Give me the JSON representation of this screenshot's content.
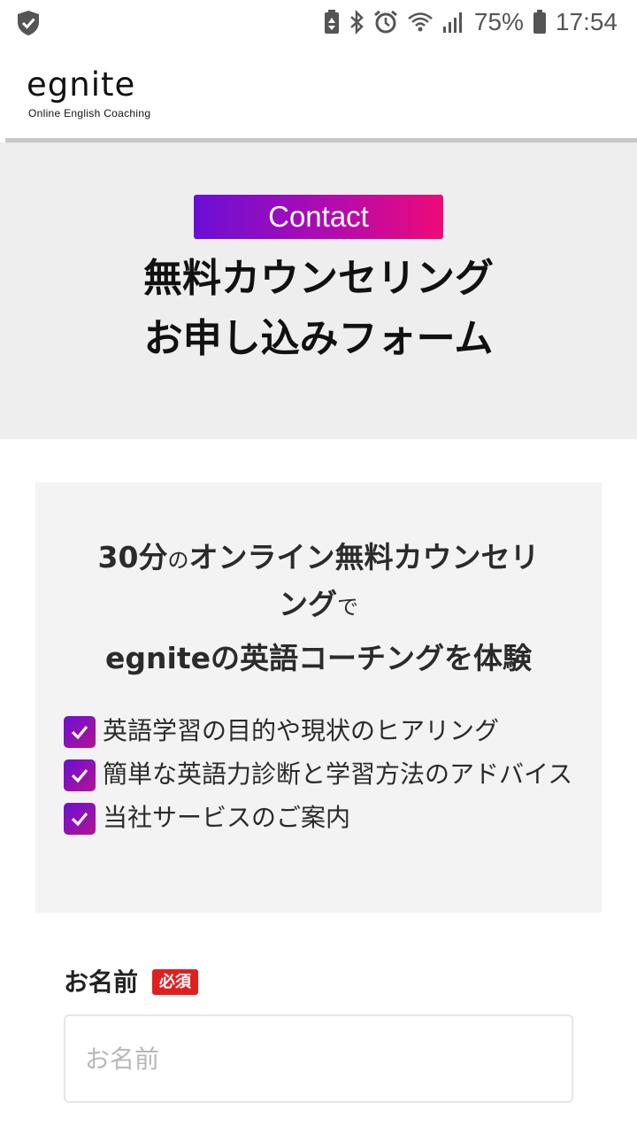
{
  "status_bar": {
    "battery_percent": "75%",
    "time": "17:54",
    "icons": [
      "shield-check-icon",
      "battery-saver-icon",
      "bluetooth-icon",
      "alarm-icon",
      "wifi-icon",
      "signal-icon",
      "battery-icon"
    ]
  },
  "header": {
    "logo_word": "egnite",
    "logo_tagline": "Online English Coaching"
  },
  "hero": {
    "badge": "Contact",
    "title_line1": "無料カウンセリング",
    "title_line2": "お申し込みフォーム"
  },
  "card": {
    "headline_part1": "30分",
    "headline_part2": "の",
    "headline_part3": "オンライン無料カウンセリ",
    "headline_part4": "ング",
    "headline_part5": "で",
    "subheadline": "egniteの英語コーチングを体験",
    "checklist": [
      "英語学習の目的や現状のヒアリング",
      "簡単な英語力診断と学習方法のアドバイス",
      "当社サービスのご案内"
    ]
  },
  "form": {
    "name_label": "お名前",
    "required_label": "必須",
    "name_placeholder": "お名前",
    "name_value": ""
  },
  "colors": {
    "gradient_start": "#6a0fd6",
    "gradient_end": "#ee0a78",
    "required_red": "#e0201f",
    "hero_bg": "#eeeeee",
    "card_bg": "#f3f3f3"
  }
}
